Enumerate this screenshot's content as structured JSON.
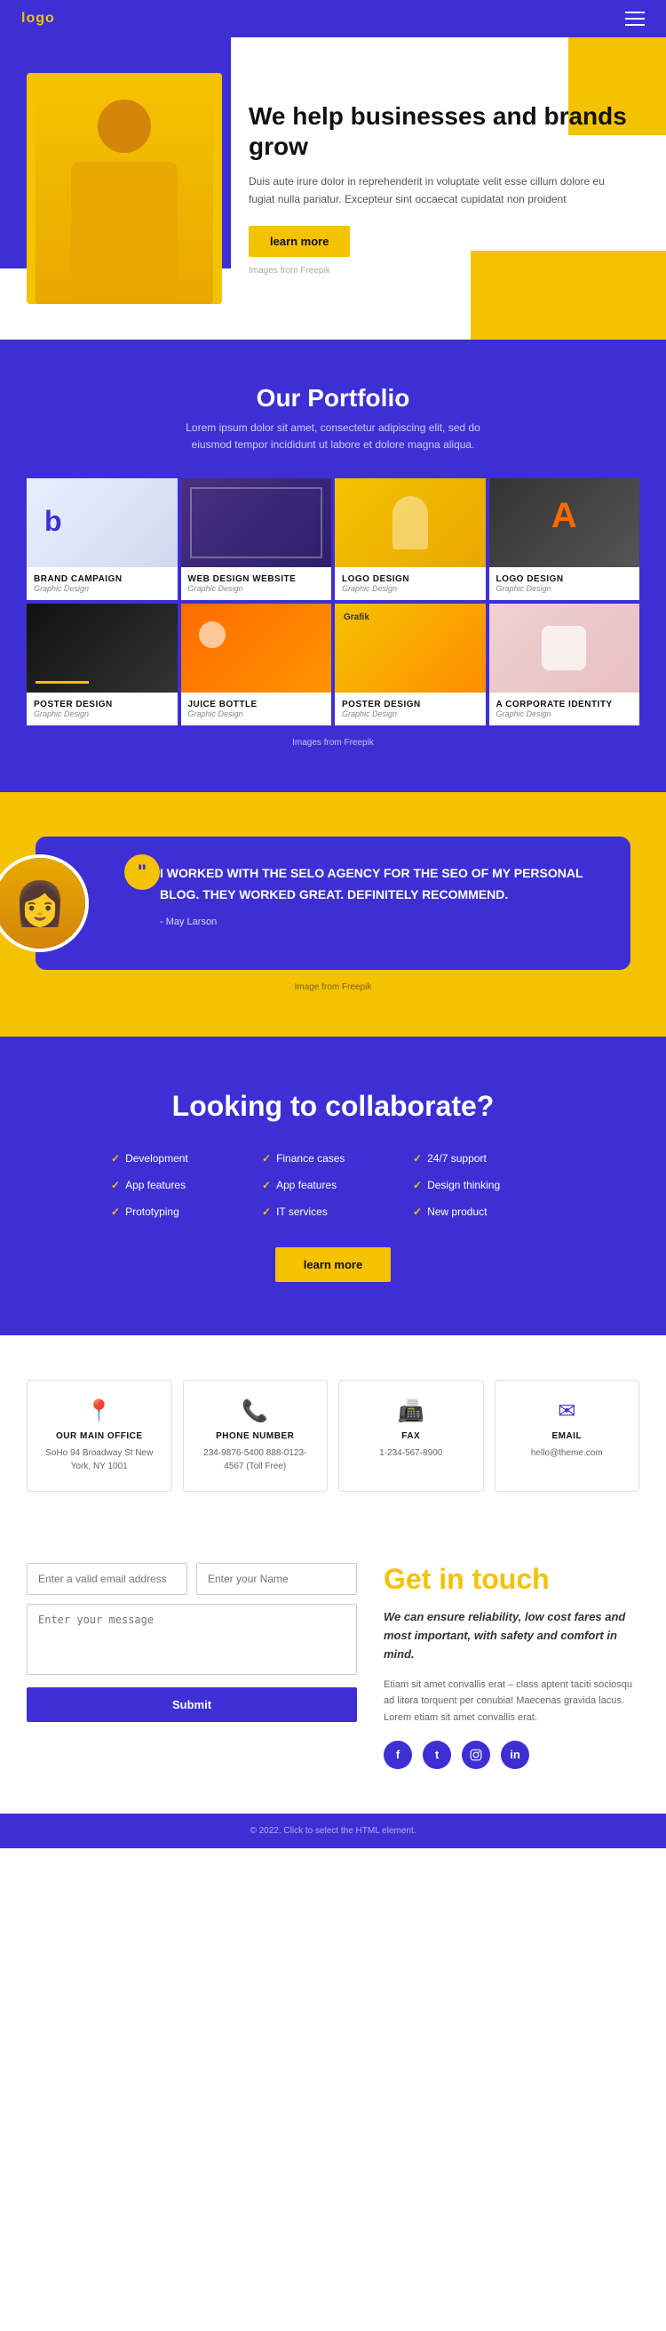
{
  "header": {
    "logo": "logo",
    "hamburger_label": "menu"
  },
  "hero": {
    "title": "We help businesses and brands grow",
    "description": "Duis aute irure dolor in reprehenderit in voluptate velit esse cillum dolore eu fugiat nulla pariatur. Excepteur sint occaecat cupidatat non proident",
    "cta_label": "learn more",
    "freepik_note": "Images from Freepik"
  },
  "portfolio": {
    "title": "Our Portfolio",
    "subtitle": "Lorem ipsum dolor sit amet, consectetur adipiscing elit, sed do eiusmod tempor incididunt ut labore et dolore magna aliqua.",
    "freepik_note": "Images from Freepik",
    "items": [
      {
        "name": "BRAND CAMPAIGN",
        "category": "Graphic Design"
      },
      {
        "name": "WEB DESIGN WEBSITE",
        "category": "Graphic Design"
      },
      {
        "name": "LOGO DESIGN",
        "category": "Graphic Design"
      },
      {
        "name": "LOGO DESIGN",
        "category": "Graphic Design"
      },
      {
        "name": "POSTER DESIGN",
        "category": "Graphic Design"
      },
      {
        "name": "JUICE BOTTLE",
        "category": "Graphic Design"
      },
      {
        "name": "POSTER DESIGN",
        "category": "Graphic Design"
      },
      {
        "name": "A CORPORATE IDENTITY",
        "category": "Graphic Design"
      }
    ]
  },
  "testimonial": {
    "quote": "I WORKED WITH THE SELO AGENCY FOR THE SEO OF MY PERSONAL BLOG. THEY WORKED GREAT. DEFINITELY RECOMMEND.",
    "author": "- May Larson",
    "freepik_note": "Image from Freepik"
  },
  "collaborate": {
    "title": "Looking to collaborate?",
    "cta_label": "learn more",
    "items": [
      "Development",
      "Finance cases",
      "24/7 support",
      "App features",
      "App features",
      "Design thinking",
      "Prototyping",
      "IT services",
      "New product"
    ]
  },
  "contact_cards": [
    {
      "icon": "📍",
      "title": "OUR MAIN OFFICE",
      "text": "SoHo 94 Broadway St New York, NY 1001"
    },
    {
      "icon": "📞",
      "title": "PHONE NUMBER",
      "text": "234-9876-5400\n888-0123-4567 (Toll Free)"
    },
    {
      "icon": "📠",
      "title": "FAX",
      "text": "1-234-567-8900"
    },
    {
      "icon": "✉",
      "title": "EMAIL",
      "text": "hello@theme.com"
    }
  ],
  "get_in_touch": {
    "title": "Get in touch",
    "highlight": "We can ensure reliability, low cost fares and most important, with safety and comfort in mind.",
    "body": "Etiam sit amet convallis erat – class aptent taciti sociosqu ad litora torquent per conubia! Maecenas gravida lacus. Lorem etiam sit amet convallis erat.",
    "form": {
      "email_placeholder": "Enter a valid email address",
      "name_placeholder": "Enter your Name",
      "message_placeholder": "Enter your message",
      "submit_label": "Submit"
    },
    "social": [
      {
        "label": "f",
        "name": "facebook"
      },
      {
        "label": "t",
        "name": "twitter"
      },
      {
        "label": "in",
        "name": "instagram"
      },
      {
        "label": "in",
        "name": "linkedin"
      }
    ]
  },
  "footer": {
    "text": "© 2022. Click to select the HTML element."
  }
}
